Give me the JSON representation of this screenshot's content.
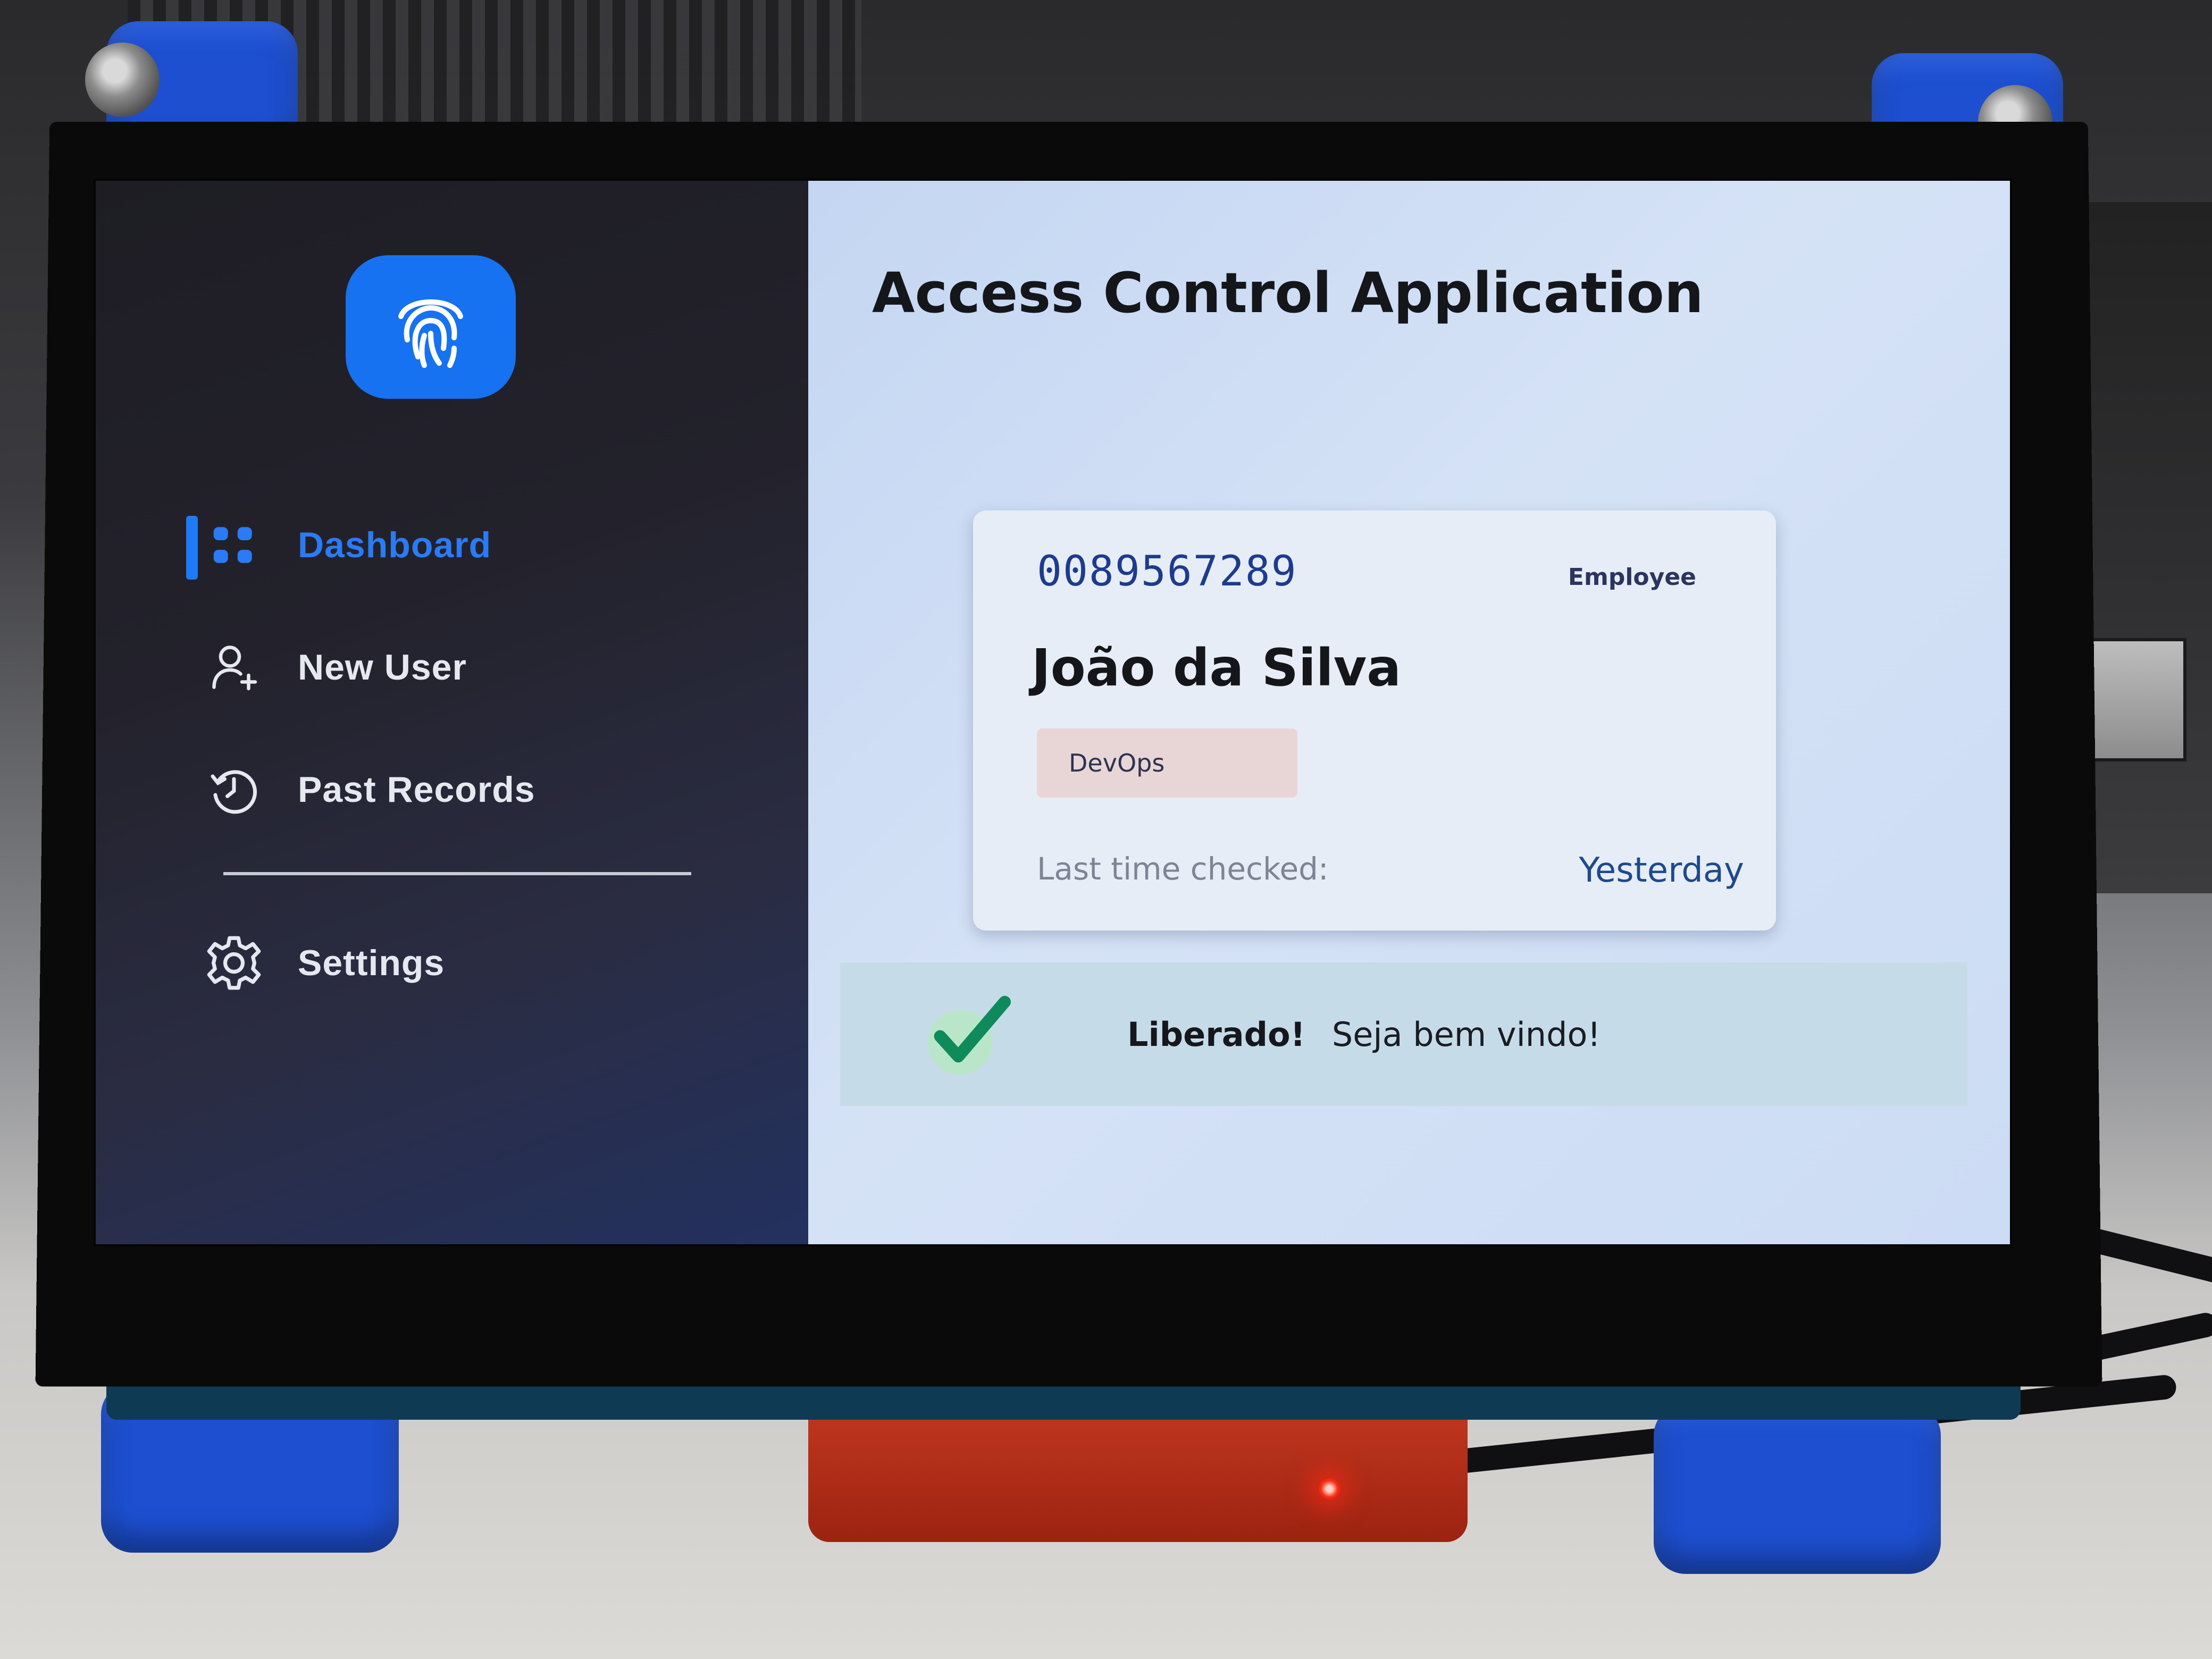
{
  "app": {
    "title": "Access Control Application"
  },
  "sidebar": {
    "logo_icon": "fingerprint-icon",
    "items": [
      {
        "label": "Dashboard",
        "icon": "dashboard-grid-icon",
        "active": true
      },
      {
        "label": "New User",
        "icon": "add-user-icon",
        "active": false
      },
      {
        "label": "Past Records",
        "icon": "history-clock-icon",
        "active": false
      }
    ],
    "settings": {
      "label": "Settings",
      "icon": "gear-icon"
    }
  },
  "card": {
    "id": "0089567289",
    "role": "Employee",
    "name": "João da Silva",
    "department": "DevOps",
    "last_checked_label": "Last time checked:",
    "last_checked_value": "Yesterday"
  },
  "status": {
    "icon": "checkmark-icon",
    "title": "Liberado!",
    "message": "Seja bem vindo!"
  },
  "colors": {
    "accent": "#1672f0",
    "sidebar_bg": "#23222c",
    "main_bg": "#d0def5",
    "success": "#0f8a5a"
  }
}
